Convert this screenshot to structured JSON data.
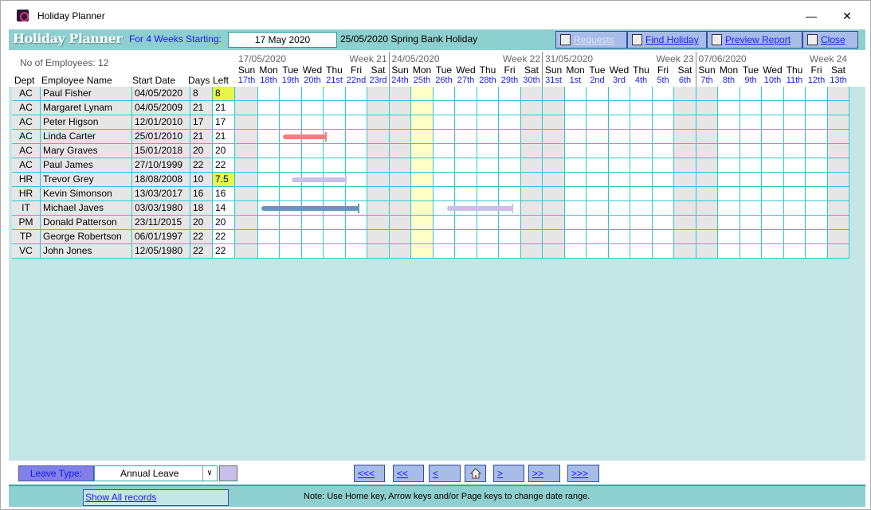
{
  "window": {
    "title": "Holiday Planner",
    "minimize_glyph": "—",
    "close_glyph": "✕"
  },
  "header": {
    "logo": "Holiday Planner",
    "weeks_label": "For 4 Weeks Starting:",
    "start_date": "17 May 2020",
    "holiday_note": "25/05/2020  Spring Bank Holiday",
    "buttons": {
      "requests": "Requests",
      "find_holiday": "Find Holiday",
      "preview_report": "Preview Report",
      "close": "Close"
    }
  },
  "grid": {
    "employee_count_label": "No of Employees:  12",
    "columns": {
      "dept": "Dept",
      "name": "Employee Name",
      "start": "Start Date",
      "days": "Days",
      "left": "Left"
    },
    "weeks": [
      {
        "start": "17/05/2020",
        "label": "Week 21",
        "days": [
          "Sun",
          "Mon",
          "Tue",
          "Wed",
          "Thu",
          "Fri",
          "Sat"
        ],
        "nums": [
          "17th",
          "18th",
          "19th",
          "20th",
          "21st",
          "22nd",
          "23rd"
        ]
      },
      {
        "start": "24/05/2020",
        "label": "Week 22",
        "days": [
          "Sun",
          "Mon",
          "Tue",
          "Wed",
          "Thu",
          "Fri",
          "Sat"
        ],
        "nums": [
          "24th",
          "25th",
          "26th",
          "27th",
          "28th",
          "29th",
          "30th"
        ]
      },
      {
        "start": "31/05/2020",
        "label": "Week 23",
        "days": [
          "Sun",
          "Mon",
          "Tue",
          "Wed",
          "Thu",
          "Fri",
          "Sat"
        ],
        "nums": [
          "31st",
          "1st",
          "2nd",
          "3rd",
          "4th",
          "5th",
          "6th"
        ]
      },
      {
        "start": "07/06/2020",
        "label": "Week 24",
        "days": [
          "Sun",
          "Mon",
          "Tue",
          "Wed",
          "Thu",
          "Fri",
          "Sat"
        ],
        "nums": [
          "7th",
          "8th",
          "9th",
          "10th",
          "11th",
          "12th",
          "13th"
        ]
      }
    ],
    "employees": [
      {
        "dept": "AC",
        "name": "Paul Fisher",
        "start": "04/05/2020",
        "days": "8",
        "left": "8",
        "low": true
      },
      {
        "dept": "AC",
        "name": "Margaret Lynam",
        "start": "04/05/2009",
        "days": "21",
        "left": "21"
      },
      {
        "dept": "AC",
        "name": "Peter Higson",
        "start": "12/01/2010",
        "days": "17",
        "left": "17"
      },
      {
        "dept": "AC",
        "name": "Linda Carter",
        "start": "25/01/2010",
        "days": "21",
        "left": "21"
      },
      {
        "dept": "AC",
        "name": "Mary Graves",
        "start": "15/01/2018",
        "days": "20",
        "left": "20"
      },
      {
        "dept": "AC",
        "name": "Paul James",
        "start": "27/10/1999",
        "days": "22",
        "left": "22"
      },
      {
        "dept": "HR",
        "name": "Trevor Grey",
        "start": "18/08/2008",
        "days": "10",
        "left": "7.5",
        "low": true
      },
      {
        "dept": "HR",
        "name": "Kevin Simonson",
        "start": "13/03/2017",
        "days": "16",
        "left": "16"
      },
      {
        "dept": "IT",
        "name": "Michael Javes",
        "start": "03/03/1980",
        "days": "18",
        "left": "14"
      },
      {
        "dept": "PM",
        "name": "Donald Patterson",
        "start": "23/11/2015",
        "days": "20",
        "left": "20"
      },
      {
        "dept": "TP",
        "name": "George Robertson",
        "start": "06/01/1997",
        "days": "22",
        "left": "22"
      },
      {
        "dept": "VC",
        "name": "John Jones",
        "start": "12/05/1980",
        "days": "22",
        "left": "22"
      }
    ],
    "holiday_day_index": 8,
    "leave": [
      {
        "row": 3,
        "from_day": 2,
        "to_day": 4,
        "color": "#f08080"
      },
      {
        "row": 6,
        "from_day": 2.4,
        "to_day": 4.9,
        "color": "#c8c0e8"
      },
      {
        "row": 8,
        "from_day": 1,
        "to_day": 5.5,
        "color": "#7090c0"
      },
      {
        "row": 8,
        "from_day": 9.5,
        "to_day": 12.5,
        "color": "#c8c0e8"
      }
    ]
  },
  "bottom": {
    "leave_type_label": "Leave Type:",
    "leave_type_value": "Annual Leave",
    "leave_type_color": "#c8c0e8",
    "nav": {
      "first": "<<<",
      "prev_page": "<<",
      "prev": "<",
      "home_icon": "home-icon",
      "next": ">",
      "next_page": ">>",
      "last": ">>>"
    }
  },
  "status": {
    "show_all": "Show All records",
    "note": "Note: Use Home key, Arrow keys and/or Page keys to change date range."
  }
}
